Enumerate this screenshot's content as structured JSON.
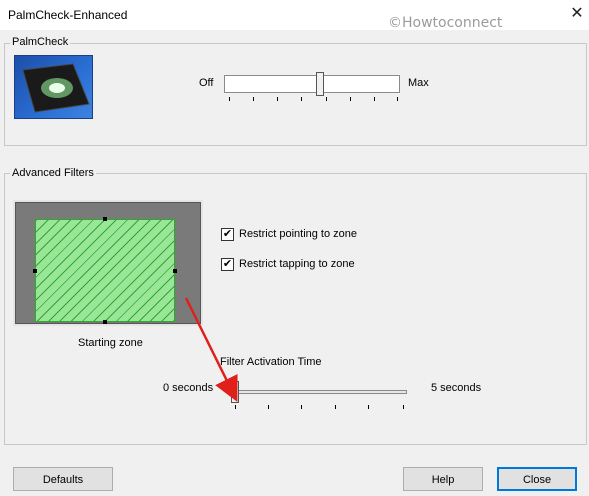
{
  "window": {
    "title": "PalmCheck-Enhanced",
    "watermark": "©Howtoconnect",
    "close_glyph": "✕"
  },
  "palmcheck": {
    "group_label": "PalmCheck",
    "icon": "touchpad-icon",
    "slider_min_label": "Off",
    "slider_max_label": "Max",
    "slider_level": 0.55
  },
  "advanced": {
    "group_label": "Advanced Filters",
    "zone_caption": "Starting zone",
    "restrict_pointing": {
      "label": "Restrict pointing to zone",
      "checked": true
    },
    "restrict_tapping": {
      "label": "Restrict tapping to zone",
      "checked": true
    },
    "filter_time": {
      "title": "Filter Activation Time",
      "min_label": "0 seconds",
      "max_label": "5 seconds",
      "level": 0.0
    }
  },
  "buttons": {
    "defaults": "Defaults",
    "help": "Help",
    "close": "Close"
  },
  "colors": {
    "zone_fill": "#99e699",
    "annotation_arrow": "#e0201a"
  }
}
